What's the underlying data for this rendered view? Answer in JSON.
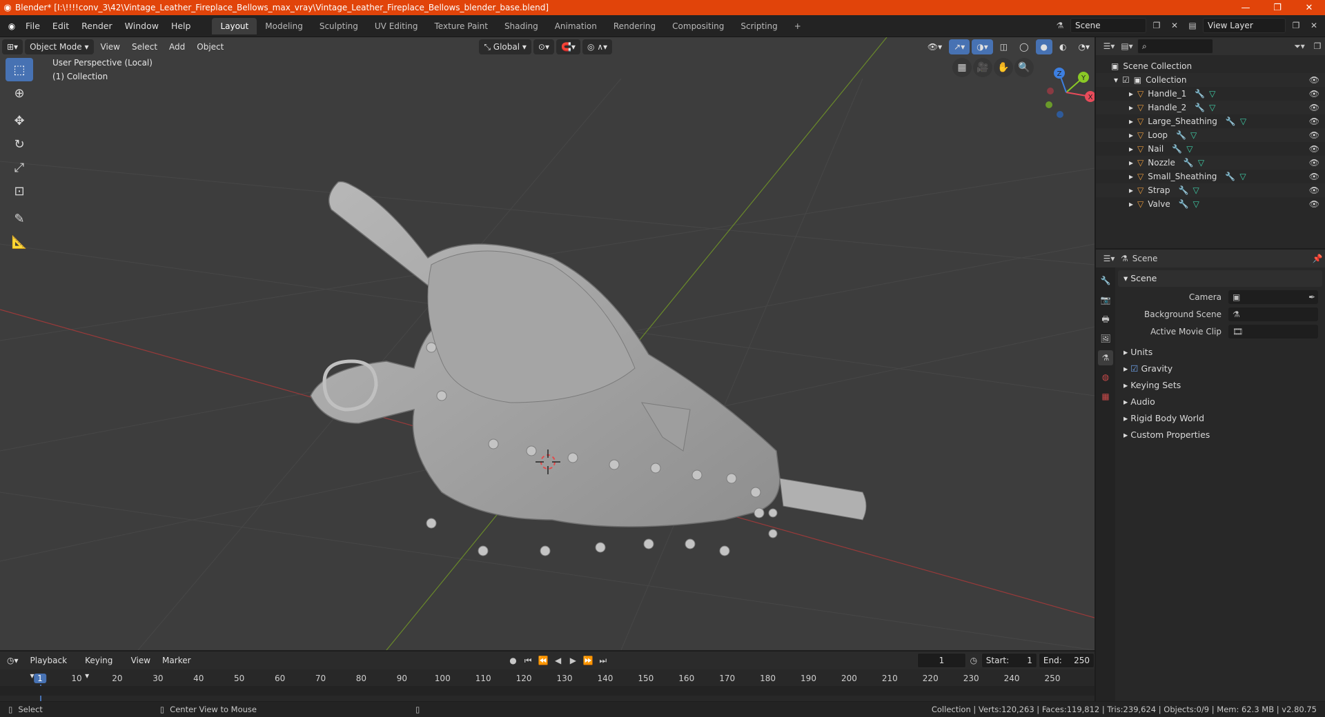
{
  "window": {
    "title": "Blender* [I:\\!!!!conv_3\\42\\Vintage_Leather_Fireplace_Bellows_max_vray\\Vintage_Leather_Fireplace_Bellows_blender_base.blend]",
    "minimize": "—",
    "maximize": "❐",
    "close": "✕"
  },
  "menu": [
    "File",
    "Edit",
    "Render",
    "Window",
    "Help"
  ],
  "workspaces": [
    "Layout",
    "Modeling",
    "Sculpting",
    "UV Editing",
    "Texture Paint",
    "Shading",
    "Animation",
    "Rendering",
    "Compositing",
    "Scripting"
  ],
  "active_workspace": "Layout",
  "add_tab": "+",
  "scene_name": "Scene",
  "view_layer": "View Layer",
  "viewport": {
    "mode": "Object Mode",
    "menus": [
      "View",
      "Select",
      "Add",
      "Object"
    ],
    "orientation": "Global",
    "info_line1": "User Perspective (Local)",
    "info_line2": "(1) Collection",
    "gizmo_axes": {
      "x": "X",
      "y": "Y",
      "z": "Z"
    },
    "colors": {
      "x": "#e84b5a",
      "y": "#8ac926",
      "z": "#3d7fe0"
    }
  },
  "outliner": {
    "search_placeholder": "",
    "root": "Scene Collection",
    "collection": "Collection",
    "objects": [
      "Handle_1",
      "Handle_2",
      "Large_Sheathing",
      "Loop",
      "Nail",
      "Nozzle",
      "Small_Sheathing",
      "Strap",
      "Valve"
    ]
  },
  "properties": {
    "context": "Scene",
    "panel": "Scene",
    "rows": [
      {
        "label": "Camera"
      },
      {
        "label": "Background Scene"
      },
      {
        "label": "Active Movie Clip"
      }
    ],
    "subpanels": [
      "Units",
      "Gravity",
      "Keying Sets",
      "Audio",
      "Rigid Body World",
      "Custom Properties"
    ]
  },
  "timeline": {
    "menus": [
      "Playback",
      "Keying",
      "View",
      "Marker"
    ],
    "current_frame": "1",
    "start_label": "Start:",
    "start": "1",
    "end_label": "End:",
    "end": "250",
    "ticks": [
      "1",
      "10",
      "20",
      "30",
      "40",
      "50",
      "60",
      "70",
      "80",
      "90",
      "100",
      "110",
      "120",
      "130",
      "140",
      "150",
      "160",
      "170",
      "180",
      "190",
      "200",
      "210",
      "220",
      "230",
      "240",
      "250"
    ]
  },
  "status": {
    "left": "Select",
    "middle": "Center View to Mouse",
    "right": "Collection | Verts:120,263 | Faces:119,812 | Tris:239,624 | Objects:0/9 | Mem: 62.3 MB | v2.80.75"
  }
}
